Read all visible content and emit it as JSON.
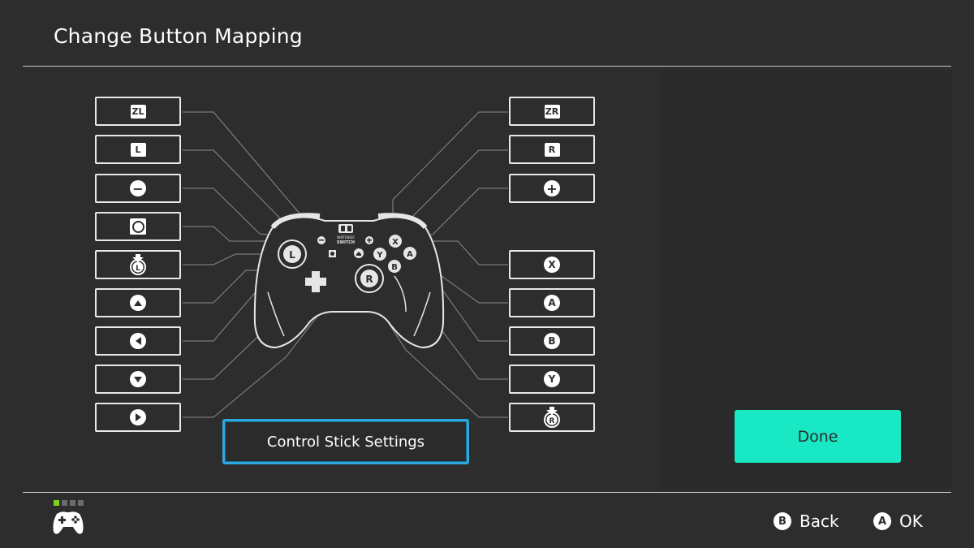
{
  "header": {
    "title": "Change Button Mapping"
  },
  "mapping": {
    "left": [
      {
        "id": "zl",
        "label": "ZL"
      },
      {
        "id": "l",
        "label": "L"
      },
      {
        "id": "minus",
        "label": "−"
      },
      {
        "id": "capture"
      },
      {
        "id": "lstick",
        "label": "L"
      },
      {
        "id": "dpad-up"
      },
      {
        "id": "dpad-left"
      },
      {
        "id": "dpad-down"
      },
      {
        "id": "dpad-right"
      }
    ],
    "right": [
      {
        "id": "zr",
        "label": "ZR"
      },
      {
        "id": "r",
        "label": "R"
      },
      {
        "id": "plus",
        "label": "+"
      },
      {
        "id": "x",
        "label": "X"
      },
      {
        "id": "a",
        "label": "A"
      },
      {
        "id": "b",
        "label": "B"
      },
      {
        "id": "y",
        "label": "Y"
      },
      {
        "id": "rstick",
        "label": "R"
      }
    ]
  },
  "controller": {
    "brand_line1": "NINTENDO",
    "brand_line2": "SWITCH",
    "buttons": {
      "x": "X",
      "y": "Y",
      "a": "A",
      "b": "B",
      "lstick": "L",
      "rstick": "R",
      "minus": "−",
      "plus": "+"
    }
  },
  "control_stick_button": "Control Stick Settings",
  "done_button": "Done",
  "footer": {
    "pages": 4,
    "active_page": 1,
    "hints": [
      {
        "button": "B",
        "label": "Back"
      },
      {
        "button": "A",
        "label": "OK"
      }
    ]
  },
  "colors": {
    "background": "#2d2d2d",
    "accent_done": "#18e8c4",
    "focus_border": "#2ea8de",
    "page_active": "#7fd21b"
  }
}
